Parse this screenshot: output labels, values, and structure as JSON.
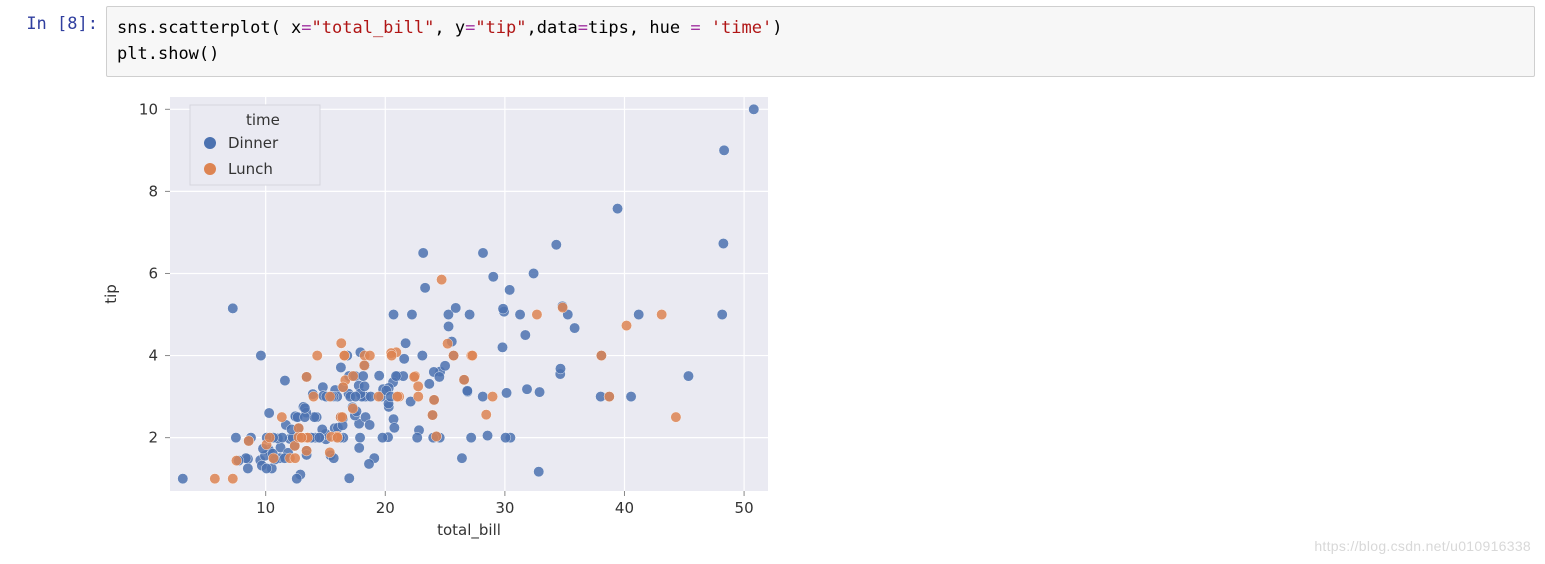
{
  "cell": {
    "prompt_prefix": "In  [",
    "prompt_num": "8",
    "prompt_suffix": "]:",
    "code_tokens": [
      {
        "t": "sns",
        "c": "tk-name"
      },
      {
        "t": ".",
        "c": ""
      },
      {
        "t": "scatterplot",
        "c": "tk-name"
      },
      {
        "t": "( x",
        "c": ""
      },
      {
        "t": "=",
        "c": "tk-op"
      },
      {
        "t": "\"total_bill\"",
        "c": "tk-str"
      },
      {
        "t": ", y",
        "c": ""
      },
      {
        "t": "=",
        "c": "tk-op"
      },
      {
        "t": "\"tip\"",
        "c": "tk-str"
      },
      {
        "t": ",data",
        "c": ""
      },
      {
        "t": "=",
        "c": "tk-op"
      },
      {
        "t": "tips, hue ",
        "c": ""
      },
      {
        "t": "=",
        "c": "tk-op"
      },
      {
        "t": " ",
        "c": ""
      },
      {
        "t": "'time'",
        "c": "tk-str"
      },
      {
        "t": ")",
        "c": ""
      },
      {
        "t": "\n",
        "c": ""
      },
      {
        "t": "plt",
        "c": "tk-name"
      },
      {
        "t": ".",
        "c": ""
      },
      {
        "t": "show",
        "c": "tk-name"
      },
      {
        "t": "()",
        "c": ""
      }
    ]
  },
  "watermark": "https://blog.csdn.net/u010916338",
  "chart_data": {
    "type": "scatter",
    "xlabel": "total_bill",
    "ylabel": "tip",
    "xlim": [
      2,
      52
    ],
    "ylim": [
      0.7,
      10.3
    ],
    "xticks": [
      10,
      20,
      30,
      40,
      50
    ],
    "yticks": [
      2,
      4,
      6,
      8,
      10
    ],
    "legend_title": "time",
    "colors": {
      "Dinner": "#4c72b0",
      "Lunch": "#dd8452"
    },
    "series": [
      {
        "name": "Dinner",
        "color": "#4c72b0",
        "points": [
          [
            16.99,
            1.01
          ],
          [
            10.34,
            1.66
          ],
          [
            21.01,
            3.5
          ],
          [
            23.68,
            3.31
          ],
          [
            24.59,
            3.61
          ],
          [
            25.29,
            4.71
          ],
          [
            8.77,
            2.0
          ],
          [
            26.88,
            3.12
          ],
          [
            15.04,
            1.96
          ],
          [
            14.78,
            3.23
          ],
          [
            10.27,
            1.71
          ],
          [
            35.26,
            5.0
          ],
          [
            15.42,
            1.57
          ],
          [
            18.43,
            3.0
          ],
          [
            14.83,
            3.02
          ],
          [
            21.58,
            3.92
          ],
          [
            10.33,
            1.67
          ],
          [
            16.29,
            3.71
          ],
          [
            16.97,
            3.5
          ],
          [
            20.65,
            3.35
          ],
          [
            17.92,
            4.08
          ],
          [
            20.29,
            2.75
          ],
          [
            15.77,
            2.23
          ],
          [
            39.42,
            7.58
          ],
          [
            19.82,
            3.18
          ],
          [
            17.81,
            2.34
          ],
          [
            13.37,
            2.0
          ],
          [
            12.69,
            2.0
          ],
          [
            21.7,
            4.3
          ],
          [
            19.65,
            3.0
          ],
          [
            9.55,
            1.45
          ],
          [
            18.35,
            2.5
          ],
          [
            15.06,
            3.0
          ],
          [
            20.69,
            2.45
          ],
          [
            17.78,
            3.27
          ],
          [
            24.06,
            3.6
          ],
          [
            16.31,
            2.0
          ],
          [
            16.93,
            3.07
          ],
          [
            18.69,
            2.31
          ],
          [
            31.27,
            5.0
          ],
          [
            16.04,
            2.24
          ],
          [
            17.46,
            2.54
          ],
          [
            13.94,
            3.06
          ],
          [
            9.68,
            1.32
          ],
          [
            30.4,
            5.6
          ],
          [
            18.29,
            3.0
          ],
          [
            22.23,
            5.0
          ],
          [
            32.4,
            6.0
          ],
          [
            28.55,
            2.05
          ],
          [
            18.04,
            3.0
          ],
          [
            12.54,
            2.5
          ],
          [
            10.29,
            2.6
          ],
          [
            34.81,
            5.2
          ],
          [
            9.94,
            1.56
          ],
          [
            25.56,
            4.34
          ],
          [
            19.49,
            3.51
          ],
          [
            38.01,
            3.0
          ],
          [
            26.41,
            1.5
          ],
          [
            11.24,
            1.76
          ],
          [
            48.27,
            6.73
          ],
          [
            20.29,
            3.21
          ],
          [
            13.81,
            2.0
          ],
          [
            11.02,
            1.98
          ],
          [
            18.29,
            3.76
          ],
          [
            17.59,
            2.64
          ],
          [
            20.08,
            3.15
          ],
          [
            16.45,
            2.47
          ],
          [
            3.07,
            1.0
          ],
          [
            20.23,
            2.01
          ],
          [
            15.01,
            2.09
          ],
          [
            12.02,
            1.97
          ],
          [
            17.07,
            3.0
          ],
          [
            26.86,
            3.14
          ],
          [
            25.28,
            5.0
          ],
          [
            14.73,
            2.2
          ],
          [
            10.51,
            1.25
          ],
          [
            17.92,
            3.08
          ],
          [
            38.07,
            4.0
          ],
          [
            23.95,
            2.55
          ],
          [
            25.71,
            4.0
          ],
          [
            17.31,
            3.5
          ],
          [
            29.93,
            5.07
          ],
          [
            10.65,
            1.5
          ],
          [
            12.43,
            1.8
          ],
          [
            24.08,
            2.92
          ],
          [
            11.69,
            2.31
          ],
          [
            13.42,
            1.68
          ],
          [
            14.26,
            2.5
          ],
          [
            15.95,
            2.0
          ],
          [
            12.48,
            2.52
          ],
          [
            29.8,
            4.2
          ],
          [
            8.52,
            1.48
          ],
          [
            14.52,
            2.0
          ],
          [
            11.38,
            2.0
          ],
          [
            22.82,
            2.18
          ],
          [
            19.08,
            1.5
          ],
          [
            20.27,
            2.83
          ],
          [
            11.17,
            1.5
          ],
          [
            12.26,
            2.0
          ],
          [
            18.26,
            3.25
          ],
          [
            8.51,
            1.25
          ],
          [
            10.33,
            2.0
          ],
          [
            14.15,
            2.0
          ],
          [
            16.0,
            2.0
          ],
          [
            13.16,
            2.75
          ],
          [
            17.47,
            3.5
          ],
          [
            34.3,
            6.7
          ],
          [
            41.19,
            5.0
          ],
          [
            27.05,
            5.0
          ],
          [
            16.43,
            2.3
          ],
          [
            8.35,
            1.5
          ],
          [
            18.64,
            1.36
          ],
          [
            11.87,
            1.63
          ],
          [
            9.78,
            1.73
          ],
          [
            7.51,
            2.0
          ],
          [
            14.07,
            2.5
          ],
          [
            13.13,
            2.0
          ],
          [
            17.26,
            2.74
          ],
          [
            24.55,
            2.0
          ],
          [
            19.77,
            2.0
          ],
          [
            29.85,
            5.14
          ],
          [
            48.17,
            5.0
          ],
          [
            25.0,
            3.75
          ],
          [
            13.39,
            2.61
          ],
          [
            16.49,
            2.0
          ],
          [
            21.5,
            3.5
          ],
          [
            12.66,
            2.5
          ],
          [
            16.21,
            2.0
          ],
          [
            13.81,
            2.0
          ],
          [
            17.51,
            3.0
          ],
          [
            24.52,
            3.48
          ],
          [
            20.76,
            2.24
          ],
          [
            31.71,
            4.5
          ],
          [
            10.59,
            1.61
          ],
          [
            10.63,
            2.0
          ],
          [
            50.81,
            10.0
          ],
          [
            15.81,
            3.16
          ],
          [
            7.25,
            5.15
          ],
          [
            31.85,
            3.18
          ],
          [
            16.82,
            4.0
          ],
          [
            32.9,
            3.11
          ],
          [
            17.89,
            2.0
          ],
          [
            14.48,
            2.0
          ],
          [
            9.6,
            4.0
          ],
          [
            34.63,
            3.55
          ],
          [
            34.65,
            3.68
          ],
          [
            23.33,
            5.65
          ],
          [
            45.35,
            3.5
          ],
          [
            23.17,
            6.5
          ],
          [
            40.55,
            3.0
          ],
          [
            20.69,
            5.0
          ],
          [
            20.9,
            3.5
          ],
          [
            30.46,
            2.0
          ],
          [
            18.15,
            3.5
          ],
          [
            23.1,
            4.0
          ],
          [
            15.69,
            1.5
          ],
          [
            16.47,
            3.23
          ],
          [
            26.59,
            3.41
          ],
          [
            38.73,
            3.0
          ],
          [
            24.27,
            2.03
          ],
          [
            12.76,
            2.23
          ],
          [
            30.06,
            2.0
          ],
          [
            25.89,
            5.16
          ],
          [
            48.33,
            9.0
          ],
          [
            13.27,
            2.5
          ],
          [
            28.17,
            6.5
          ],
          [
            12.9,
            1.1
          ],
          [
            28.15,
            3.0
          ],
          [
            11.59,
            1.5
          ],
          [
            7.74,
            1.44
          ],
          [
            30.14,
            3.09
          ],
          [
            12.16,
            2.2
          ],
          [
            13.42,
            3.48
          ],
          [
            8.58,
            1.92
          ],
          [
            15.98,
            3.0
          ],
          [
            13.42,
            1.58
          ],
          [
            16.27,
            2.5
          ],
          [
            10.09,
            2.0
          ],
          [
            20.45,
            3.0
          ],
          [
            13.28,
            2.72
          ],
          [
            22.12,
            2.88
          ],
          [
            24.01,
            2.0
          ],
          [
            15.69,
            3.0
          ],
          [
            11.61,
            3.39
          ],
          [
            10.77,
            1.47
          ],
          [
            15.53,
            3.0
          ],
          [
            10.07,
            1.25
          ],
          [
            12.6,
            1.0
          ],
          [
            32.83,
            1.17
          ],
          [
            35.83,
            4.67
          ],
          [
            29.03,
            5.92
          ],
          [
            27.18,
            2.0
          ],
          [
            22.67,
            2.0
          ],
          [
            17.82,
            1.75
          ],
          [
            18.78,
            3.0
          ]
        ]
      },
      {
        "name": "Lunch",
        "color": "#dd8452",
        "points": [
          [
            27.2,
            4.0
          ],
          [
            22.76,
            3.0
          ],
          [
            17.29,
            2.71
          ],
          [
            19.44,
            3.0
          ],
          [
            16.66,
            3.4
          ],
          [
            10.07,
            1.83
          ],
          [
            32.68,
            5.0
          ],
          [
            15.98,
            2.03
          ],
          [
            34.83,
            5.17
          ],
          [
            13.03,
            2.0
          ],
          [
            18.28,
            4.0
          ],
          [
            24.71,
            5.85
          ],
          [
            21.16,
            3.0
          ],
          [
            28.97,
            3.0
          ],
          [
            22.49,
            3.5
          ],
          [
            5.75,
            1.0
          ],
          [
            16.32,
            4.3
          ],
          [
            22.75,
            3.25
          ],
          [
            40.17,
            4.73
          ],
          [
            27.28,
            4.0
          ],
          [
            12.03,
            1.5
          ],
          [
            21.01,
            3.0
          ],
          [
            12.46,
            1.5
          ],
          [
            11.35,
            2.5
          ],
          [
            15.38,
            3.0
          ],
          [
            44.3,
            2.5
          ],
          [
            22.42,
            3.48
          ],
          [
            20.92,
            4.08
          ],
          [
            15.36,
            1.64
          ],
          [
            20.49,
            4.06
          ],
          [
            25.21,
            4.29
          ],
          [
            18.24,
            3.76
          ],
          [
            14.31,
            4.0
          ],
          [
            14.0,
            3.0
          ],
          [
            7.25,
            1.0
          ],
          [
            38.07,
            4.0
          ],
          [
            23.95,
            2.55
          ],
          [
            25.71,
            4.0
          ],
          [
            17.31,
            3.5
          ],
          [
            10.65,
            1.5
          ],
          [
            12.43,
            1.8
          ],
          [
            24.08,
            2.92
          ],
          [
            13.42,
            1.68
          ],
          [
            16.58,
            4.0
          ],
          [
            15.98,
            2.03
          ],
          [
            16.27,
            2.5
          ],
          [
            12.76,
            2.23
          ],
          [
            13.37,
            2.0
          ],
          [
            28.44,
            2.56
          ],
          [
            15.48,
            2.02
          ],
          [
            16.58,
            4.0
          ],
          [
            7.56,
            1.44
          ],
          [
            10.34,
            2.0
          ],
          [
            43.11,
            5.0
          ],
          [
            13.0,
            2.0
          ],
          [
            13.51,
            2.0
          ],
          [
            18.71,
            4.0
          ],
          [
            12.74,
            2.01
          ],
          [
            13.0,
            2.0
          ],
          [
            16.4,
            2.5
          ],
          [
            20.53,
            4.0
          ],
          [
            16.47,
            3.23
          ],
          [
            26.59,
            3.41
          ],
          [
            38.73,
            3.0
          ],
          [
            24.27,
            2.03
          ],
          [
            8.58,
            1.92
          ],
          [
            13.42,
            3.48
          ],
          [
            16.0,
            2.0
          ]
        ]
      }
    ]
  }
}
